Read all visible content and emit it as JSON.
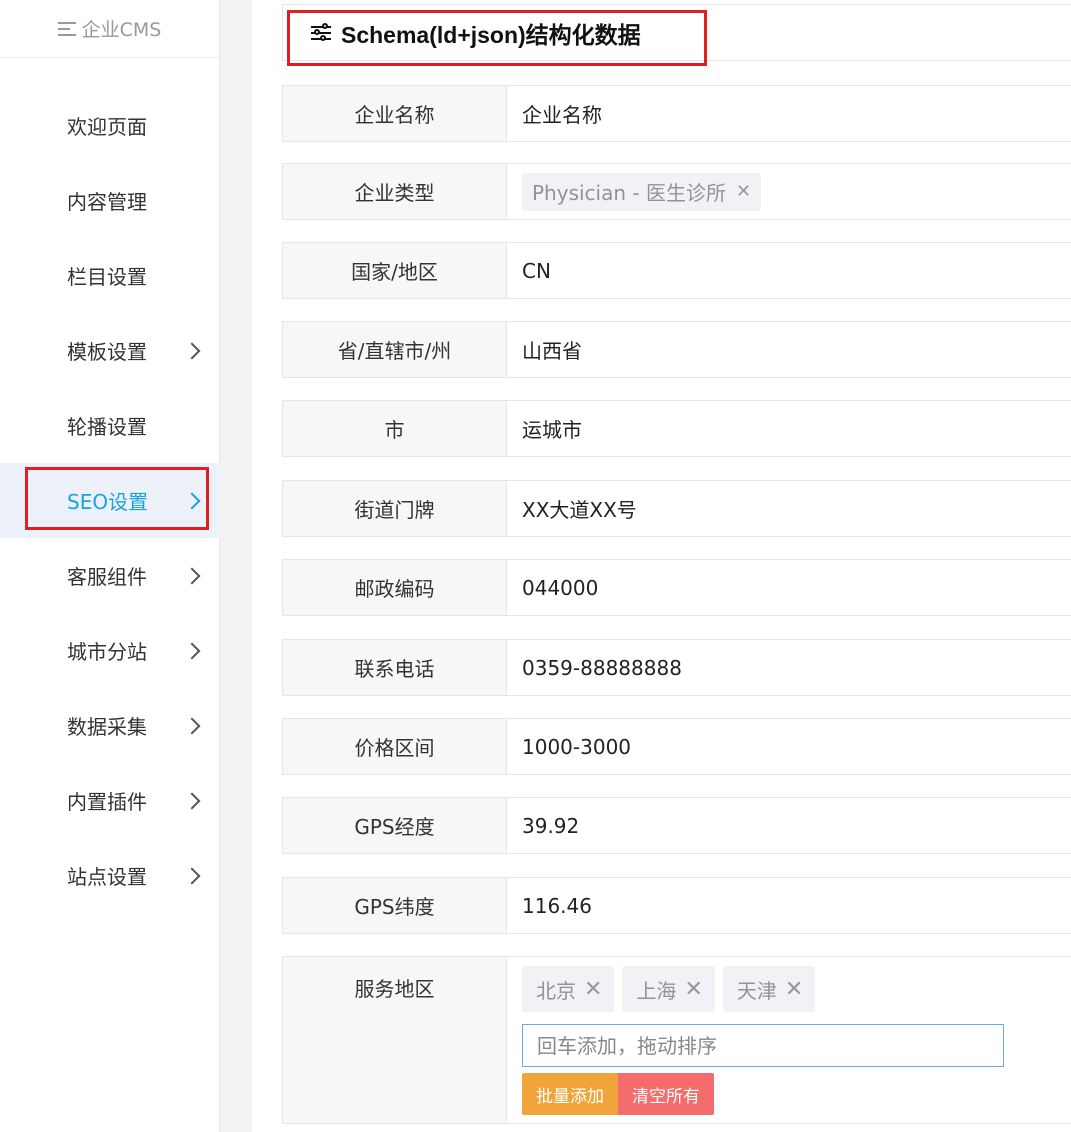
{
  "sidebar": {
    "logo_text": "企业CMS",
    "items": [
      {
        "label": "欢迎页面",
        "chevron": false,
        "active": false
      },
      {
        "label": "内容管理",
        "chevron": false,
        "active": false
      },
      {
        "label": "栏目设置",
        "chevron": false,
        "active": false
      },
      {
        "label": "模板设置",
        "chevron": true,
        "active": false
      },
      {
        "label": "轮播设置",
        "chevron": false,
        "active": false
      },
      {
        "label": "SEO设置",
        "chevron": true,
        "active": true
      },
      {
        "label": "客服组件",
        "chevron": true,
        "active": false
      },
      {
        "label": "城市分站",
        "chevron": true,
        "active": false
      },
      {
        "label": "数据采集",
        "chevron": true,
        "active": false
      },
      {
        "label": "内置插件",
        "chevron": true,
        "active": false
      },
      {
        "label": "站点设置",
        "chevron": true,
        "active": false
      }
    ]
  },
  "section": {
    "title": "Schema(ld+json)结构化数据"
  },
  "form": {
    "company_name": {
      "label": "企业名称",
      "value": "企业名称"
    },
    "company_type": {
      "label": "企业类型",
      "tag": "Physician - 医生诊所"
    },
    "country": {
      "label": "国家/地区",
      "value": "CN"
    },
    "province": {
      "label": "省/直辖市/州",
      "value": "山西省"
    },
    "city": {
      "label": "市",
      "value": "运城市"
    },
    "street": {
      "label": "街道门牌",
      "value": "XX大道XX号"
    },
    "postal": {
      "label": "邮政编码",
      "value": "044000"
    },
    "phone": {
      "label": "联系电话",
      "value": "0359-88888888"
    },
    "price": {
      "label": "价格区间",
      "value": "1000-3000"
    },
    "longitude": {
      "label": "GPS经度",
      "value": "39.92"
    },
    "latitude": {
      "label": "GPS纬度",
      "value": "116.46"
    },
    "service_area": {
      "label": "服务地区",
      "tags": [
        "北京",
        "上海",
        "天津"
      ],
      "input_placeholder": "回车添加，拖动排序",
      "batch_add_label": "批量添加",
      "clear_all_label": "清空所有"
    }
  },
  "colors": {
    "accent": "#1aa3e0",
    "highlight": "#e02020",
    "warn": "#f0a43a",
    "danger": "#f56c6c"
  }
}
